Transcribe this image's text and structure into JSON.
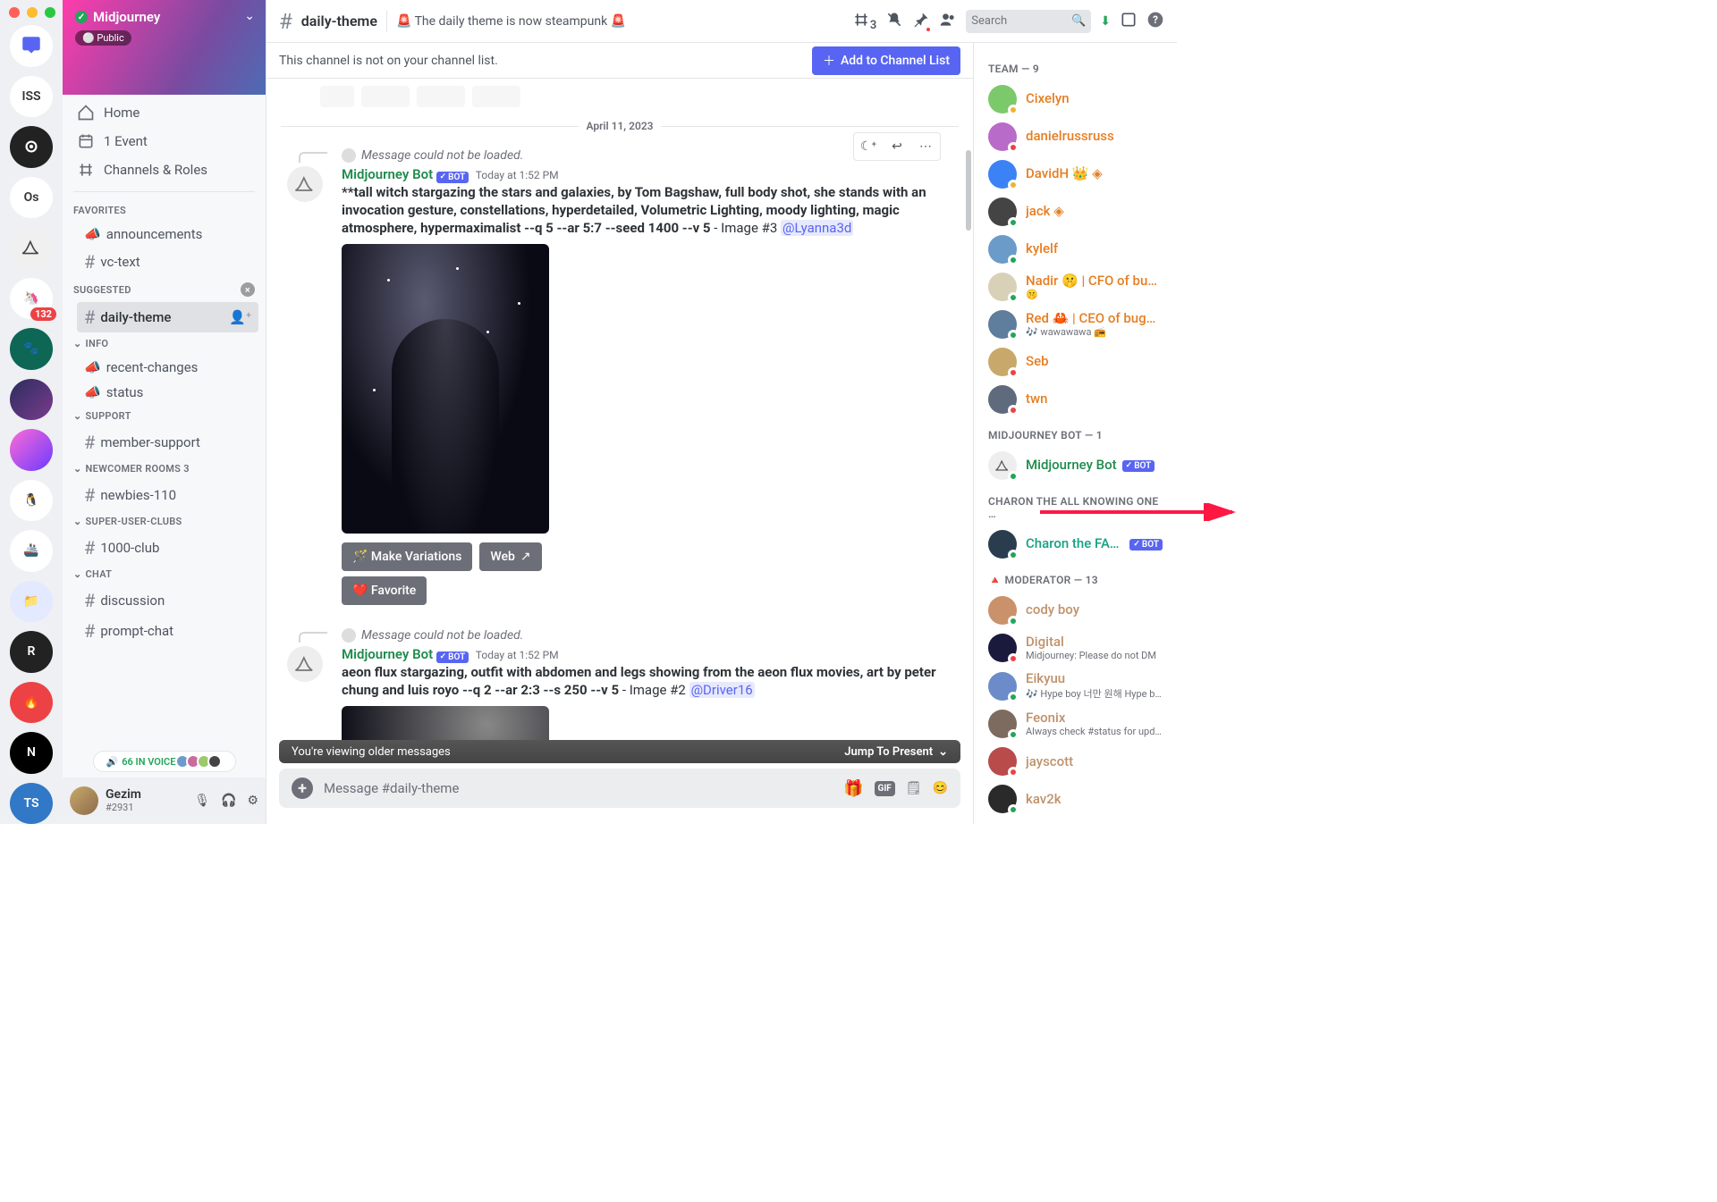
{
  "server": {
    "name": "Midjourney",
    "public_label": "⚪ Public",
    "badge_132": "132"
  },
  "servers_list": [
    "ISS",
    "",
    "Os",
    "",
    "",
    "",
    "",
    "",
    "",
    "",
    "",
    "",
    "R",
    "",
    "N",
    "TS"
  ],
  "nav": {
    "home": "Home",
    "event": "1 Event",
    "channels_roles": "Channels & Roles"
  },
  "categories": {
    "favorites": "FAVORITES",
    "suggested": "SUGGESTED",
    "info": "INFO",
    "support": "SUPPORT",
    "newcomer": "NEWCOMER ROOMS 3",
    "superuser": "SUPER-USER-CLUBS",
    "chat": "CHAT"
  },
  "channels": {
    "announcements": "announcements",
    "vctext": "vc-text",
    "dailytheme": "daily-theme",
    "recentchanges": "recent-changes",
    "status": "status",
    "membersupport": "member-support",
    "newbies": "newbies-110",
    "club1000": "1000-club",
    "discussion": "discussion",
    "promptchat": "prompt-chat"
  },
  "voice_pill": "66 IN VOICE",
  "user": {
    "name": "Gezim",
    "tag": "#2931"
  },
  "topbar": {
    "channel": "daily-theme",
    "topic": "🚨 The daily theme is now steampunk 🚨",
    "threads": "3",
    "search_placeholder": "Search"
  },
  "notice": {
    "text": "This channel is not on your channel list.",
    "btn": "Add to Channel List"
  },
  "date_divider": "April 11, 2023",
  "msg1": {
    "notloaded": "Message could not be loaded.",
    "author": "Midjourney Bot",
    "bot": "BOT",
    "time": "Today at 1:52 PM",
    "prompt_bold": "**tall witch stargazing the stars and galaxies, by Tom Bagshaw, full body shot, she stands with an invocation gesture, constellations, hyperdetailed, Volumetric Lighting, moody lighting, magic atmosphere, hypermaximalist --q 5 --ar 5:7 --seed 1400 --v 5",
    "suffix": " - Image #3 ",
    "mention": "@Lyanna3d",
    "btn_variations": "🪄 Make Variations",
    "btn_web": "Web",
    "btn_fav": "❤️ Favorite"
  },
  "msg2": {
    "notloaded": "Message could not be loaded.",
    "author": "Midjourney Bot",
    "bot": "BOT",
    "time": "Today at 1:52 PM",
    "prompt": "aeon flux stargazing, outfit with abdomen and legs showing from the aeon flux movies, art by peter chung and luis royo --q 2 --ar 2:3 --s 250 --v 5",
    "suffix": " - Image #2 ",
    "mention": "@Driver16"
  },
  "older_bar": {
    "text": "You're viewing older messages",
    "jump": "Jump To Present"
  },
  "composer": {
    "placeholder": "Message #daily-theme"
  },
  "mcats": {
    "team": "TEAM — 9",
    "bot": "MIDJOURNEY BOT — 1",
    "charon": "CHARON THE ALL KNOWING ONE …",
    "mod": "🔺 MODERATOR — 13"
  },
  "team": [
    {
      "n": "Cixelyn",
      "c": "col-orange",
      "s": "idle",
      "av": "#7cc96b"
    },
    {
      "n": "danielrussruss",
      "c": "col-orange",
      "s": "dnd",
      "av": "#b96bc9"
    },
    {
      "n": "DavidH 👑 ◈",
      "c": "col-orange",
      "s": "idle",
      "av": "#3b82f6"
    },
    {
      "n": "jack ◈",
      "c": "col-orange",
      "s": "on",
      "av": "#444"
    },
    {
      "n": "kylelf",
      "c": "col-orange",
      "s": "on",
      "av": "#6b9bc9"
    },
    {
      "n": "Nadir 🤫 | CFO of bug…",
      "sub": "🤫",
      "c": "col-orange",
      "s": "on",
      "av": "#d9d0b8"
    },
    {
      "n": "Red 🦀 | CEO of bugs 🐛",
      "sub": "🎶 wawawawa 📻",
      "c": "col-orange",
      "s": "on",
      "av": "#5f7d9c"
    },
    {
      "n": "Seb",
      "sub": "",
      "c": "col-orange",
      "s": "dnd",
      "av": "#c9a96b"
    },
    {
      "n": "twn",
      "c": "col-orange",
      "s": "dnd",
      "av": "#5f6b7d"
    }
  ],
  "bot_member": {
    "n": "Midjourney Bot",
    "bot": "BOT"
  },
  "charon_member": {
    "n": "Charon the FAQ …",
    "bot": "BOT"
  },
  "mods": [
    {
      "n": "cody boy",
      "c": "col-tan",
      "s": "on",
      "av": "#c9926b"
    },
    {
      "n": "Digital",
      "sub": "Midjourney: Please do not DM",
      "c": "col-tan",
      "s": "dnd",
      "av": "#1a1a3d"
    },
    {
      "n": "Eikyuu",
      "sub": "🎶 Hype boy 너만 원해 Hype b…",
      "c": "col-tan",
      "s": "on",
      "av": "#6b8cc9"
    },
    {
      "n": "Feonix",
      "sub": "Always check #status for upd…",
      "c": "col-tan",
      "s": "on",
      "av": "#7d6b5f"
    },
    {
      "n": "jayscott",
      "c": "col-tan",
      "s": "dnd",
      "av": "#b94b4b"
    },
    {
      "n": "kav2k",
      "c": "col-tan",
      "s": "on",
      "av": "#2a2a2a"
    }
  ]
}
